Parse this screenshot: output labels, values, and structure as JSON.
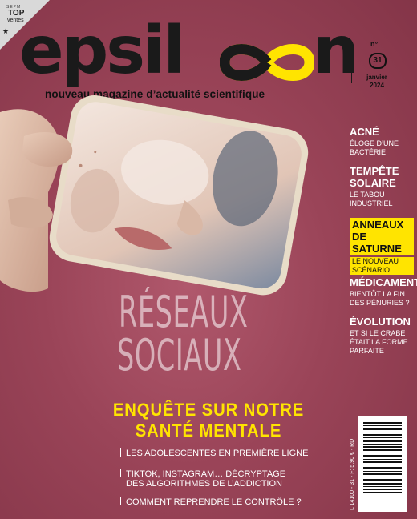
{
  "badge": {
    "org": "SEPM",
    "label": "TOP",
    "sub": "ventes"
  },
  "masthead": {
    "logo_start": "epsil",
    "logo_end": "n",
    "tagline": "nouveau magazine d’actualité scientifique",
    "issue_prefix": "n°",
    "issue_number": "31",
    "month": "janvier",
    "year": "2024"
  },
  "sidebar": [
    {
      "title": "ACNÉ",
      "subtitle": "ÉLOGE D’UNE BACTÉRIE",
      "highlight": false
    },
    {
      "title": "TEMPÊTE SOLAIRE",
      "subtitle": "LE TABOU INDUSTRIEL",
      "highlight": false
    },
    {
      "title": "ANNEAUX DE SATURNE",
      "subtitle": "LE NOUVEAU SCÉNARIO",
      "highlight": true
    },
    {
      "title": "MÉDICAMENTS",
      "subtitle": "BIENTÔT LA FIN DES PÉNURIES ?",
      "highlight": false
    },
    {
      "title": "ÉVOLUTION",
      "subtitle": "ET SI LE CRABE ÉTAIT LA FORME PARFAITE",
      "highlight": false
    }
  ],
  "cover_story": {
    "line1": "RÉSEAUX",
    "line2": "SOCIAUX",
    "headline1": "ENQUÊTE SUR NOTRE",
    "headline2": "SANTÉ MENTALE",
    "bullets": [
      "LES ADOLESCENTES EN PREMIÈRE LIGNE",
      "TIKTOK, INSTAGRAM… DÉCRYPTAGE",
      "DES ALGORITHMES DE L’ADDICTION",
      "COMMENT REPRENDRE LE CONTRÔLE ?"
    ]
  },
  "barcode": {
    "code": "L 14100 - 31 - F: 5,90 € - RD",
    "price": "5,90 €"
  },
  "colors": {
    "background": "#9a4458",
    "accent": "#ffe400",
    "logo": "#1a1a1a"
  }
}
